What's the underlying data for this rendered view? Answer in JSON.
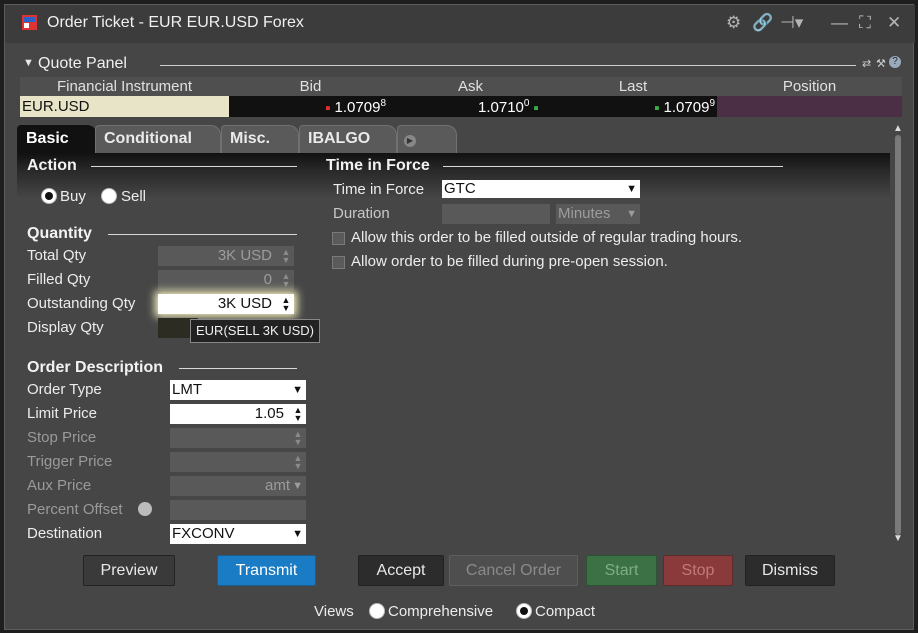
{
  "window": {
    "title": "Order Ticket - EUR EUR.USD Forex"
  },
  "quote_panel": {
    "title": "Quote Panel",
    "columns": [
      "Financial Instrument",
      "Bid",
      "Ask",
      "Last",
      "Position"
    ],
    "row": {
      "instrument": "EUR.USD",
      "bid": "1.0709",
      "bid_sup": "8",
      "ask": "1.0710",
      "ask_sup": "0",
      "last": "1.0709",
      "last_sup": "9",
      "position": ""
    }
  },
  "tabs": [
    "Basic",
    "Conditional",
    "Misc.",
    "IBALGO"
  ],
  "action": {
    "title": "Action",
    "buy": "Buy",
    "sell": "Sell"
  },
  "quantity": {
    "title": "Quantity",
    "total_label": "Total Qty",
    "total_value": "3K USD",
    "filled_label": "Filled Qty",
    "filled_value": "0",
    "outstanding_label": "Outstanding Qty",
    "outstanding_value": "3K USD",
    "display_label": "Display Qty",
    "tooltip": "EUR(SELL 3K USD)"
  },
  "order_desc": {
    "title": "Order Description",
    "order_type_label": "Order Type",
    "order_type": "LMT",
    "limit_label": "Limit Price",
    "limit_value": "1.05",
    "stop_label": "Stop Price",
    "trigger_label": "Trigger Price",
    "aux_label": "Aux Price",
    "aux_value": "amt",
    "pct_label": "Percent Offset",
    "dest_label": "Destination",
    "dest_value": "FXCONV"
  },
  "tif": {
    "title": "Time in Force",
    "tif_label": "Time in Force",
    "tif_value": "GTC",
    "duration_label": "Duration",
    "duration_unit": "Minutes",
    "opt1": "Allow this order to be filled outside of regular trading hours.",
    "opt2": "Allow order to be filled during pre-open session."
  },
  "buttons": {
    "preview": "Preview",
    "transmit": "Transmit",
    "accept": "Accept",
    "cancel": "Cancel Order",
    "start": "Start",
    "stop": "Stop",
    "dismiss": "Dismiss"
  },
  "views": {
    "label": "Views",
    "comprehensive": "Comprehensive",
    "compact": "Compact"
  },
  "colors": {
    "transmit": "#1a7cc4",
    "start": "#3c7045",
    "stop": "#8a3a3a",
    "position_cell": "#4a2f45",
    "instrument_cell": "#e8e4c8"
  }
}
